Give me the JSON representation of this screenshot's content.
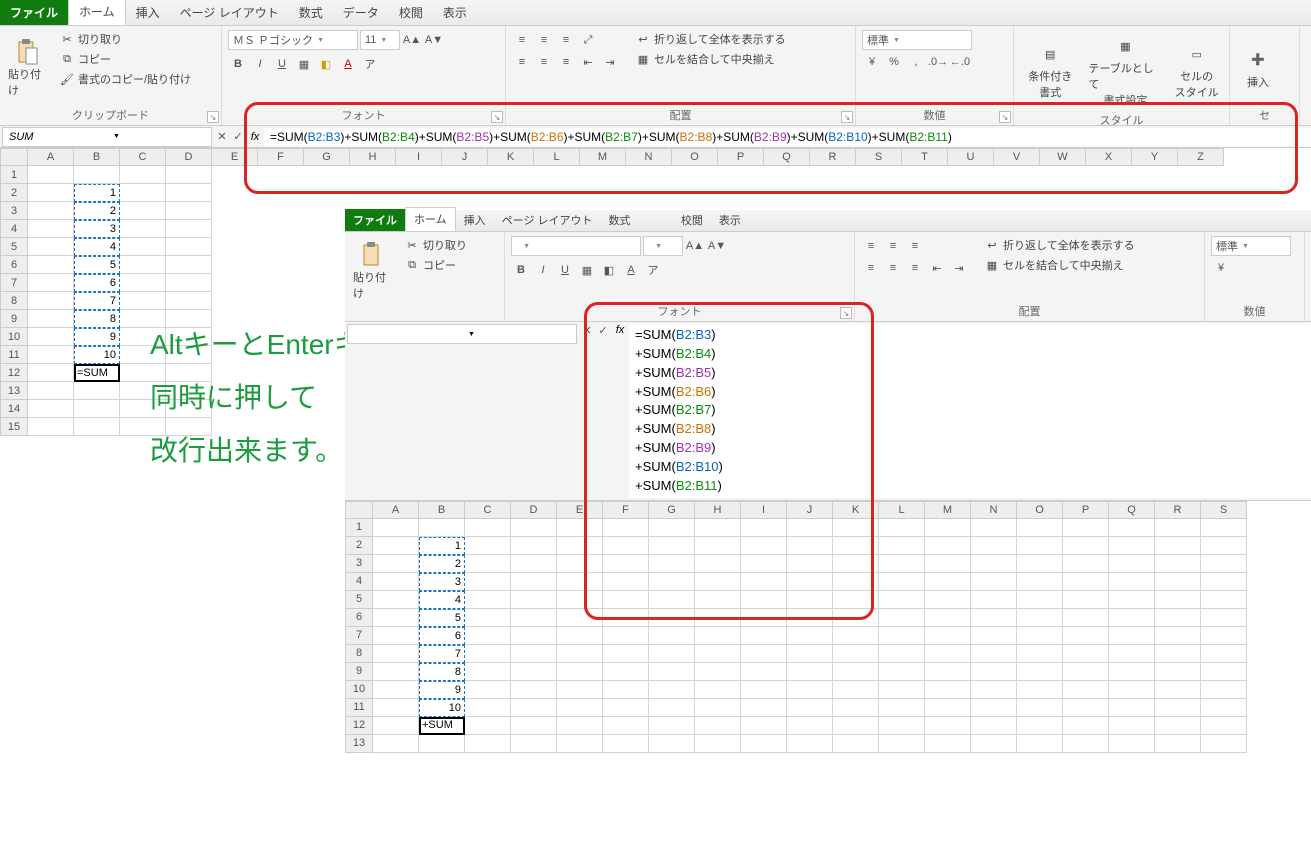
{
  "tabs": {
    "file": "ファイル",
    "home": "ホーム",
    "insert": "挿入",
    "pagelayout": "ページ レイアウト",
    "formulas": "数式",
    "data": "データ",
    "review": "校閲",
    "view": "表示"
  },
  "clipboard": {
    "paste": "貼り付け",
    "cut": "切り取り",
    "copy": "コピー",
    "formatpainter": "書式のコピー/貼り付け",
    "group": "クリップボード"
  },
  "font": {
    "name": "ＭＳ Ｐゴシック",
    "size": "11",
    "group": "フォント"
  },
  "alignment": {
    "wrap": "折り返して全体を表示する",
    "merge": "セルを結合して中央揃え",
    "group": "配置"
  },
  "number": {
    "format": "標準",
    "group": "数値"
  },
  "styles": {
    "cond": "条件付き",
    "table": "テーブルとして",
    "cell": "セルの",
    "s1": "書式",
    "s2": "書式設定",
    "s3": "スタイル",
    "group": "スタイル"
  },
  "cells": {
    "insert": "挿入",
    "group": "セ"
  },
  "namebox": "SUM",
  "formula_parts": [
    "=SUM(",
    "B2:B3",
    ")+SUM(",
    "B2:B4",
    ")+SUM(",
    "B2:B5",
    ")+SUM(",
    "B2:B6",
    ")+SUM(",
    "B2:B7",
    ")+SUM(",
    "B2:B8",
    ")+SUM(",
    "B2:B9",
    ")+SUM(",
    "B2:B10",
    ")+SUM(",
    "B2:B11",
    ")"
  ],
  "formula_classes": [
    "",
    "rf-b",
    "",
    "rf-g",
    "",
    "rf-p",
    "",
    "rf-o",
    "",
    "rf-g",
    "",
    "rf-o",
    "",
    "rf-p",
    "",
    "rf-b",
    "",
    "rf-g",
    ""
  ],
  "cols1": [
    "A",
    "B",
    "C",
    "D",
    "E",
    "F",
    "G",
    "H",
    "I",
    "J",
    "K",
    "L",
    "M",
    "N",
    "O",
    "P",
    "Q",
    "R",
    "S",
    "T",
    "U",
    "V",
    "W",
    "X",
    "Y",
    "Z"
  ],
  "rows1": [
    "1",
    "2",
    "3",
    "4",
    "5",
    "6",
    "7",
    "8",
    "9",
    "10",
    "11",
    "12",
    "13",
    "14",
    "15"
  ],
  "data1": {
    "2": "1",
    "3": "2",
    "4": "3",
    "5": "4",
    "6": "5",
    "7": "6",
    "8": "7",
    "9": "8",
    "10": "9",
    "11": "10",
    "12": "=SUM"
  },
  "instruction": {
    "l1": "AltキーとEnterキーを",
    "l2": "同時に押して",
    "l3": "改行出来ます。"
  },
  "formula2_lines": [
    [
      "=SUM(",
      "B2:B3",
      ")"
    ],
    [
      "+SUM(",
      "B2:B4",
      ")"
    ],
    [
      "+SUM(",
      "B2:B5",
      ")"
    ],
    [
      "+SUM(",
      "B2:B6",
      ")"
    ],
    [
      "+SUM(",
      "B2:B7",
      ")"
    ],
    [
      "+SUM(",
      "B2:B8",
      ")"
    ],
    [
      "+SUM(",
      "B2:B9",
      ")"
    ],
    [
      "+SUM(",
      "B2:B10",
      ")"
    ],
    [
      "+SUM(",
      "B2:B11",
      ")"
    ]
  ],
  "formula2_classes": [
    [
      "",
      "rf-b",
      ""
    ],
    [
      "",
      "rf-g",
      ""
    ],
    [
      "",
      "rf-p",
      ""
    ],
    [
      "",
      "rf-o",
      ""
    ],
    [
      "",
      "rf-g",
      ""
    ],
    [
      "",
      "rf-o",
      ""
    ],
    [
      "",
      "rf-p",
      ""
    ],
    [
      "",
      "rf-b",
      ""
    ],
    [
      "",
      "rf-g",
      ""
    ]
  ],
  "cols2": [
    "A",
    "B",
    "C",
    "D",
    "E",
    "F",
    "G",
    "H",
    "I",
    "J",
    "K",
    "L",
    "M",
    "N",
    "O",
    "P",
    "Q",
    "R",
    "S"
  ],
  "rows2": [
    "1",
    "2",
    "3",
    "4",
    "5",
    "6",
    "7",
    "8",
    "9",
    "10",
    "11",
    "12",
    "13"
  ],
  "data2": {
    "2": "1",
    "3": "2",
    "4": "3",
    "5": "4",
    "6": "5",
    "7": "6",
    "8": "7",
    "9": "8",
    "10": "9",
    "11": "10",
    "12": "+SUM"
  }
}
